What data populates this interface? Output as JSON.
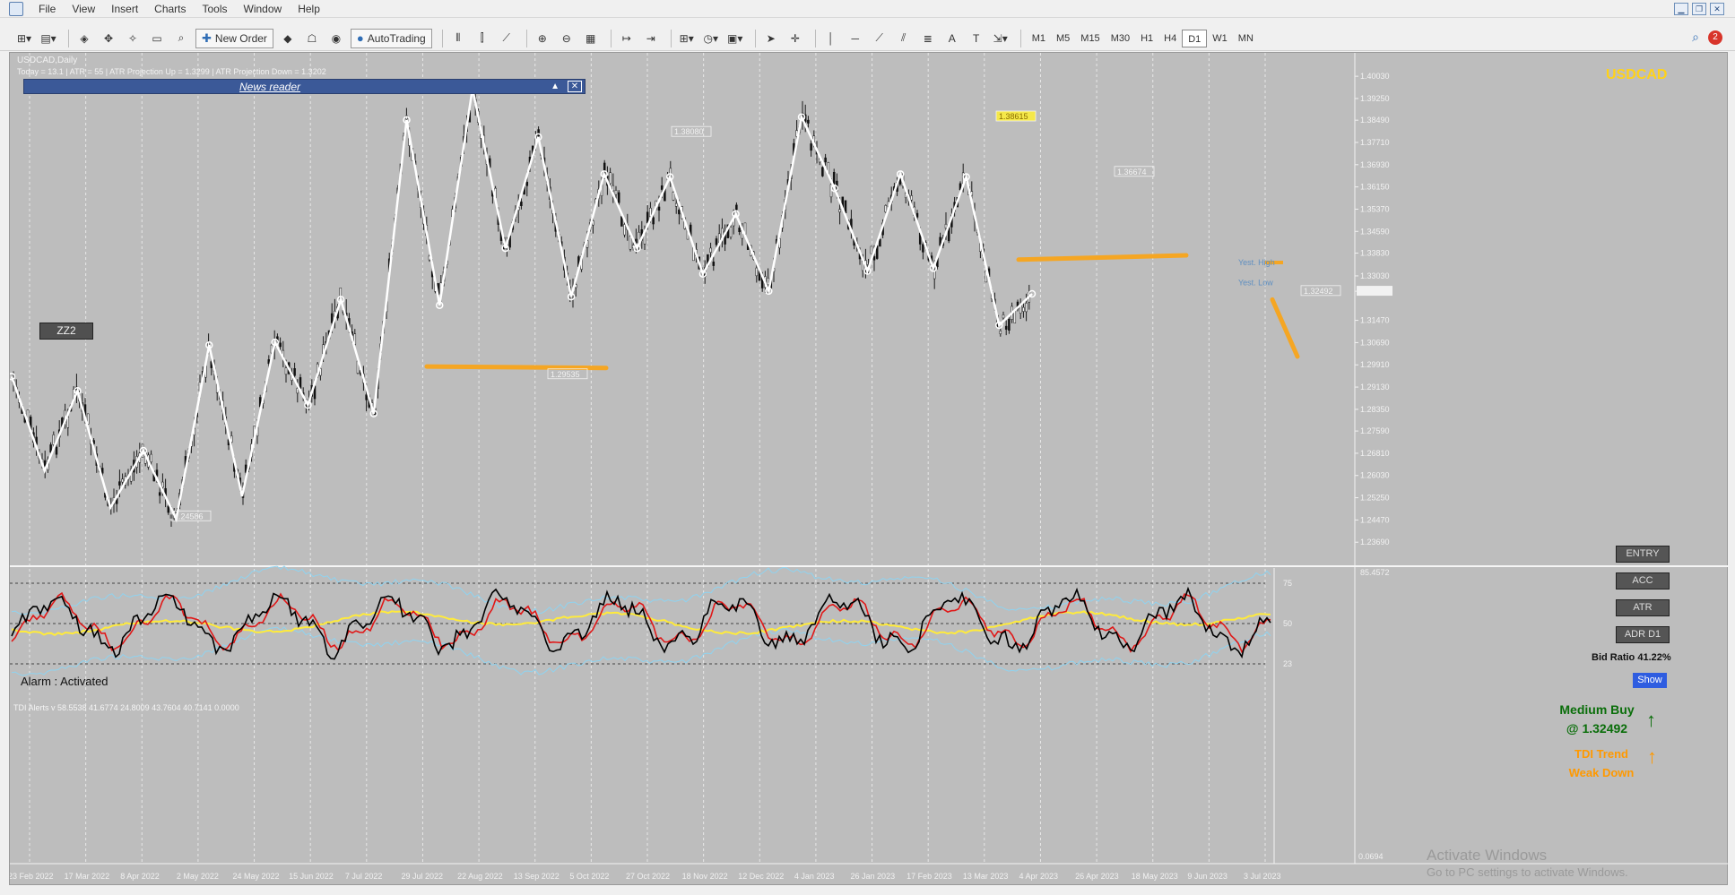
{
  "menu": [
    "File",
    "View",
    "Insert",
    "Charts",
    "Tools",
    "Window",
    "Help"
  ],
  "toolbar": {
    "new_order": "New Order",
    "autotrading": "AutoTrading",
    "timeframes": [
      "M1",
      "M5",
      "M15",
      "M30",
      "H1",
      "H4",
      "D1",
      "W1",
      "MN"
    ],
    "active_tf": "D1",
    "notifications": "2"
  },
  "chart": {
    "title": "USDCAD,Daily",
    "info": "Today = 13.1   |   ATR = 55   |   ATR Projection Up = 1.3299   |   ATR Projection Down = 1.3202",
    "news_label": "News reader",
    "zz2": "ZZ2",
    "alarm": "Alarm : Activated",
    "symbol": "USDCAD",
    "buttons": {
      "entry": "ENTRY",
      "acc": "ACC",
      "atr": "ATR",
      "adr": "ADR D1",
      "show": "Show"
    },
    "bid_ratio": "Bid Ratio 41.22%",
    "price_labels": [
      "1.38080",
      "1.38615",
      "1.36674",
      "1.32492",
      "1.24586",
      "1.29535"
    ],
    "yest_high": "Yest. High",
    "yest_low": "Yest. Low",
    "tdi_header": "TDI Alerts v 58.5538 41.6774 24.8009 43.7604 40.7141 0.0000",
    "signal": {
      "line1": "Medium Buy",
      "line2": "@ 1.32492",
      "trend1": "TDI Trend",
      "trend2": "Weak Down"
    },
    "indicator_levels": [
      "75",
      "50",
      "23"
    ],
    "indicator_axis": [
      "85.4572",
      "0.0694"
    ],
    "watermark1": "Activate Windows",
    "watermark2": "Go to PC settings to activate Windows."
  },
  "chart_data": {
    "type": "line",
    "title": "USDCAD,Daily",
    "y_ticks": [
      "1.40030",
      "1.39250",
      "1.38490",
      "1.37710",
      "1.36930",
      "1.36150",
      "1.35370",
      "1.34590",
      "1.33830",
      "1.33030",
      "1.32492",
      "1.31470",
      "1.30690",
      "1.29910",
      "1.29130",
      "1.28350",
      "1.27590",
      "1.26810",
      "1.26030",
      "1.25250",
      "1.24470",
      "1.23690"
    ],
    "x_labels": [
      "23 Feb 2022",
      "17 Mar 2022",
      "8 Apr 2022",
      "2 May 2022",
      "24 May 2022",
      "15 Jun 2022",
      "7 Jul 2022",
      "29 Jul 2022",
      "22 Aug 2022",
      "13 Sep 2022",
      "5 Oct 2022",
      "27 Oct 2022",
      "18 Nov 2022",
      "12 Dec 2022",
      "4 Jan 2023",
      "26 Jan 2023",
      "17 Feb 2023",
      "13 Mar 2023",
      "4 Apr 2023",
      "26 Apr 2023",
      "18 May 2023",
      "9 Jun 2023",
      "3 Jul 2023"
    ],
    "zigzag": [
      1.295,
      1.262,
      1.29,
      1.249,
      1.269,
      1.245,
      1.306,
      1.253,
      1.307,
      1.285,
      1.322,
      1.282,
      1.385,
      1.32,
      1.396,
      1.34,
      1.379,
      1.323,
      1.366,
      1.34,
      1.365,
      1.331,
      1.352,
      1.325,
      1.386,
      1.361,
      1.332,
      1.366,
      1.333,
      1.365,
      1.313,
      1.324
    ],
    "ylim": [
      1.231,
      1.406
    ],
    "current_price": 1.32492
  }
}
